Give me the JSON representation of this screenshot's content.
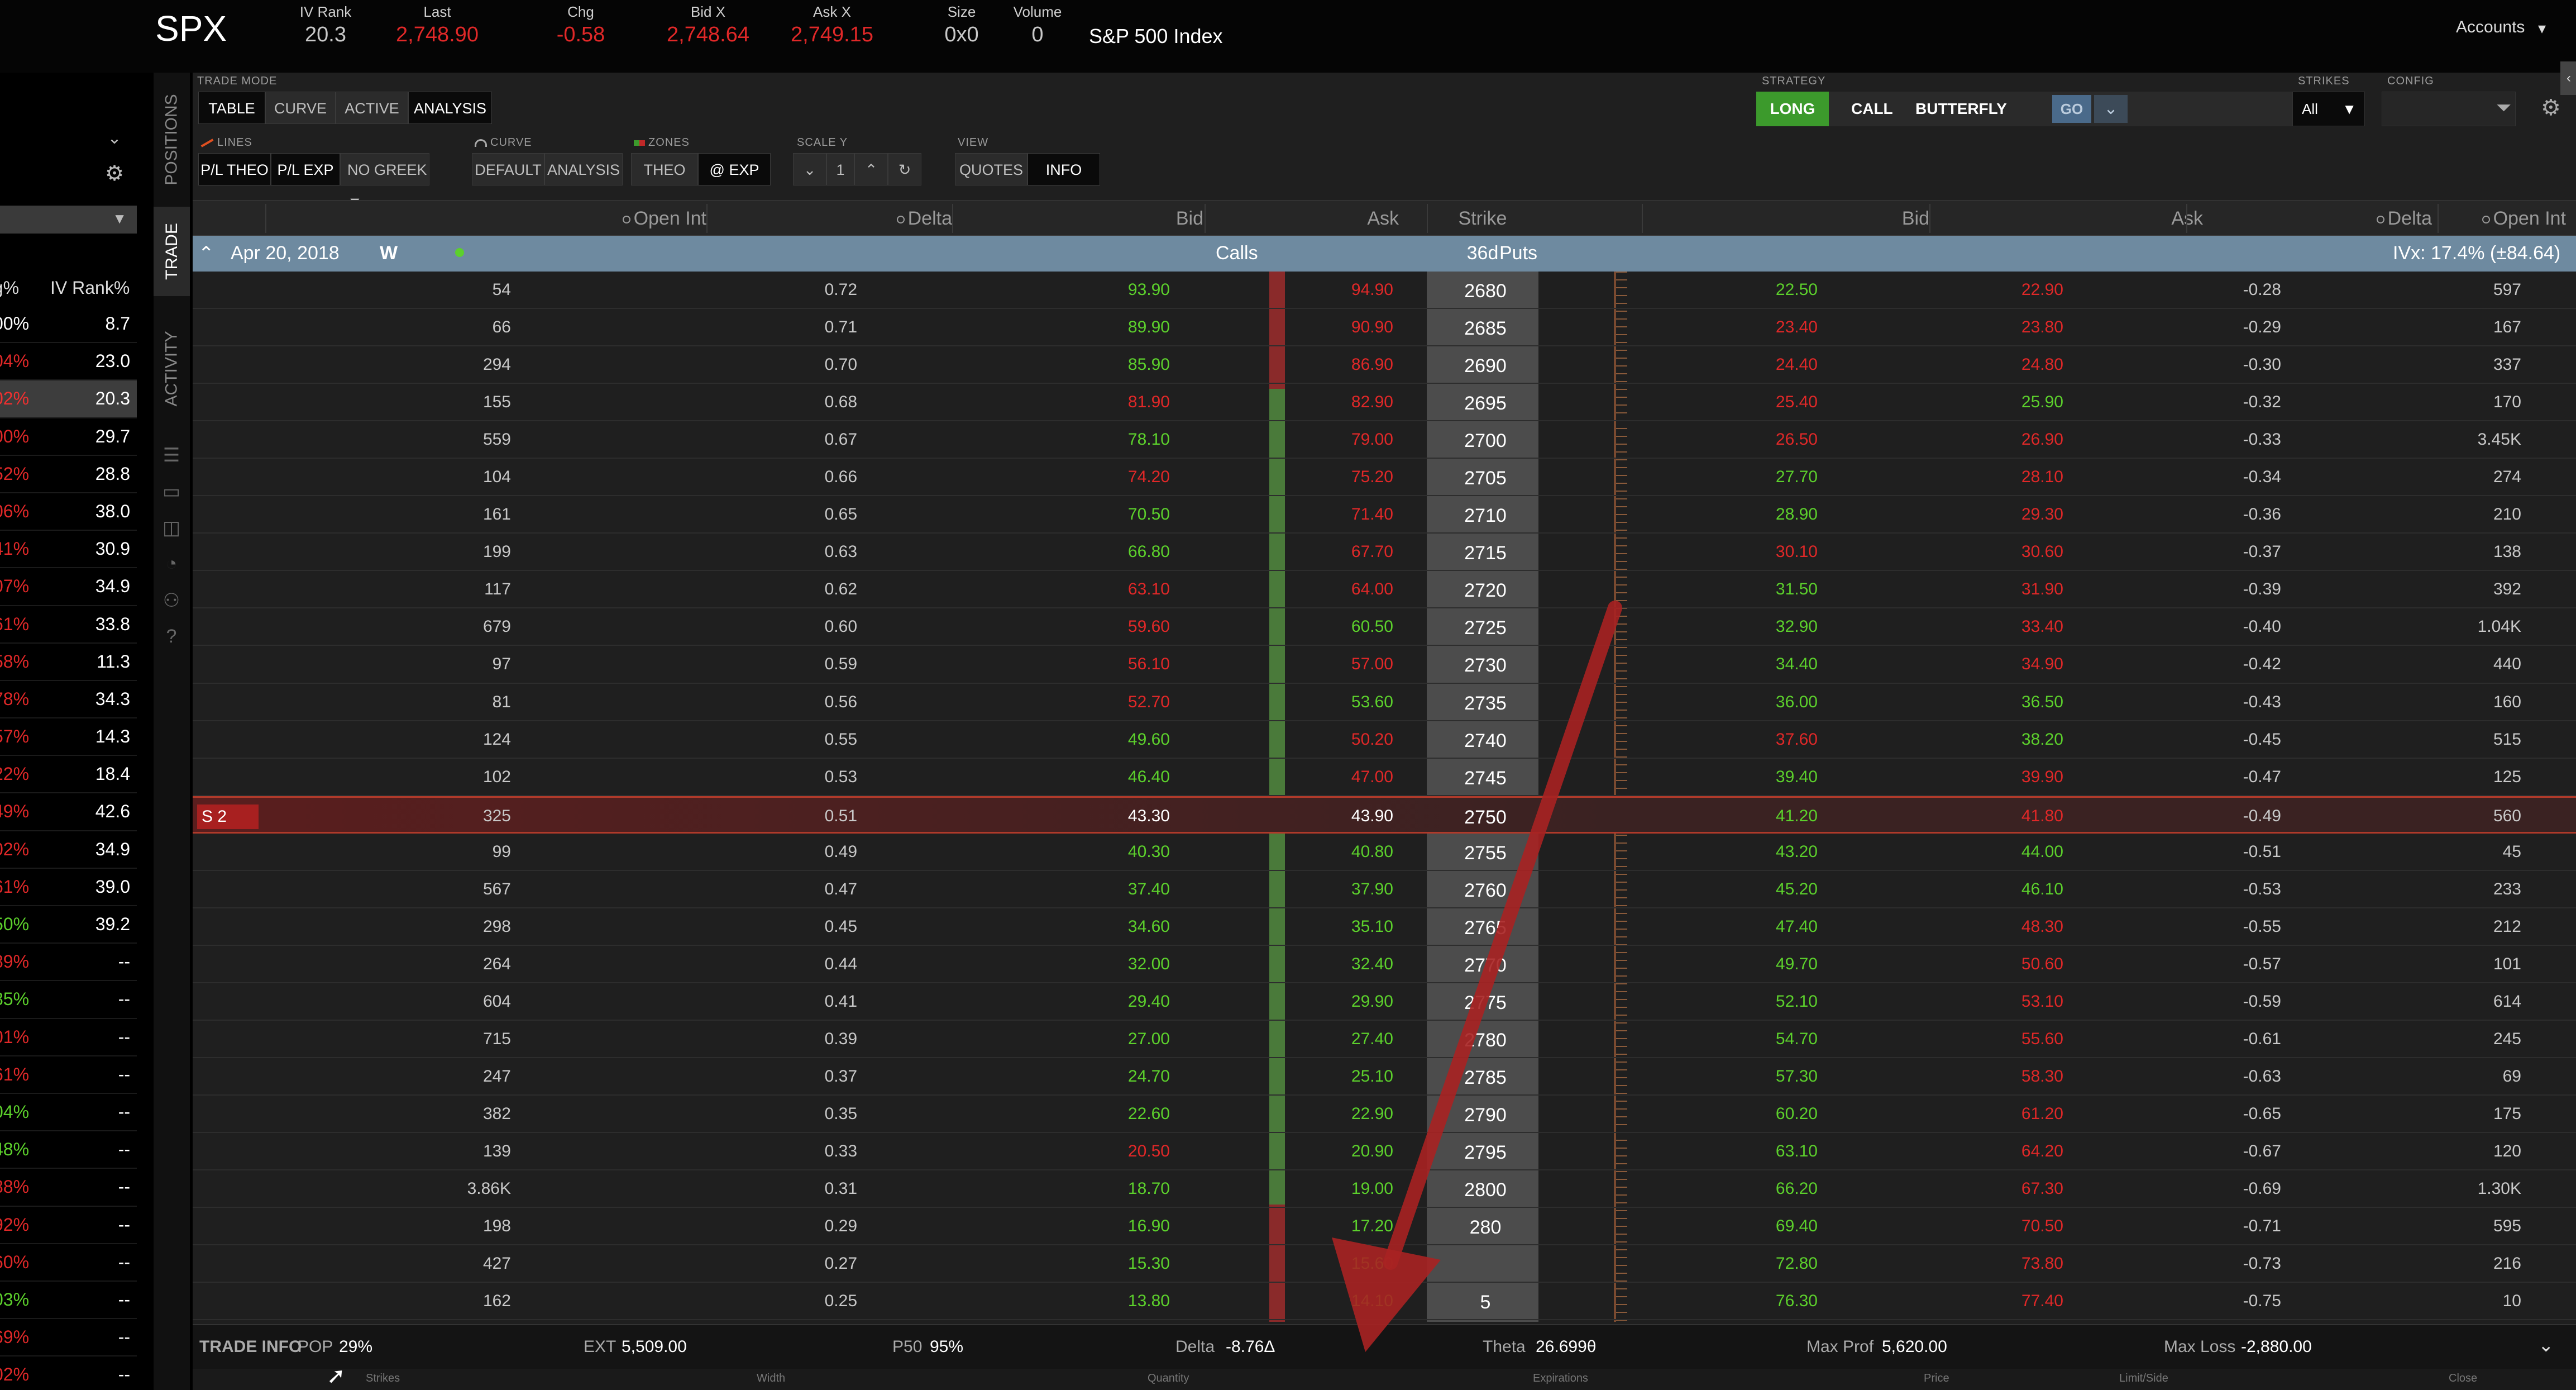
{
  "header": {
    "symbol": "SPX",
    "stats": [
      {
        "label": "IV Rank",
        "value": "20.3",
        "color": "grey"
      },
      {
        "label": "Last",
        "value": "2,748.90",
        "color": "red"
      },
      {
        "label": "Chg",
        "value": "-0.58",
        "color": "red"
      },
      {
        "label": "Bid X",
        "value": "2,748.64",
        "color": "red"
      },
      {
        "label": "Ask X",
        "value": "2,749.15",
        "color": "red"
      },
      {
        "label": "Size",
        "value": "0x0",
        "color": "grey"
      },
      {
        "label": "Volume",
        "value": "0",
        "color": "grey"
      }
    ],
    "index_name": "S&P 500 Index",
    "accounts_label": "Accounts"
  },
  "watchlist": {
    "col_pct": "hg%",
    "col_ivr": "IV Rank%",
    "rows": [
      {
        "pct": "00%",
        "ivr": "8.7",
        "pct_color": "white"
      },
      {
        "pct": "04%",
        "ivr": "23.0",
        "pct_color": "red"
      },
      {
        "pct": "02%",
        "ivr": "20.3",
        "pct_color": "red",
        "selected": true
      },
      {
        "pct": "00%",
        "ivr": "29.7",
        "pct_color": "red"
      },
      {
        "pct": "52%",
        "ivr": "28.8",
        "pct_color": "red"
      },
      {
        "pct": "06%",
        "ivr": "38.0",
        "pct_color": "red"
      },
      {
        "pct": "41%",
        "ivr": "30.9",
        "pct_color": "red"
      },
      {
        "pct": "07%",
        "ivr": "34.9",
        "pct_color": "red"
      },
      {
        "pct": "61%",
        "ivr": "33.8",
        "pct_color": "red"
      },
      {
        "pct": "58%",
        "ivr": "11.3",
        "pct_color": "red"
      },
      {
        "pct": "78%",
        "ivr": "34.3",
        "pct_color": "red"
      },
      {
        "pct": "57%",
        "ivr": "14.3",
        "pct_color": "red"
      },
      {
        "pct": "22%",
        "ivr": "18.4",
        "pct_color": "red"
      },
      {
        "pct": "49%",
        "ivr": "42.6",
        "pct_color": "red"
      },
      {
        "pct": "02%",
        "ivr": "34.9",
        "pct_color": "red"
      },
      {
        "pct": "61%",
        "ivr": "39.0",
        "pct_color": "red"
      },
      {
        "pct": "50%",
        "ivr": "39.2",
        "pct_color": "green"
      },
      {
        "pct": "89%",
        "ivr": "--",
        "pct_color": "red"
      },
      {
        "pct": "85%",
        "ivr": "--",
        "pct_color": "green"
      },
      {
        "pct": "01%",
        "ivr": "--",
        "pct_color": "red"
      },
      {
        "pct": "61%",
        "ivr": "--",
        "pct_color": "red"
      },
      {
        "pct": "04%",
        "ivr": "--",
        "pct_color": "green"
      },
      {
        "pct": "48%",
        "ivr": "--",
        "pct_color": "green"
      },
      {
        "pct": "88%",
        "ivr": "--",
        "pct_color": "red"
      },
      {
        "pct": "92%",
        "ivr": "--",
        "pct_color": "red"
      },
      {
        "pct": "60%",
        "ivr": "--",
        "pct_color": "red"
      },
      {
        "pct": "03%",
        "ivr": "--",
        "pct_color": "green"
      },
      {
        "pct": "69%",
        "ivr": "--",
        "pct_color": "red"
      },
      {
        "pct": "02%",
        "ivr": "--",
        "pct_color": "red"
      }
    ]
  },
  "vtabs": {
    "positions": "POSITIONS",
    "trade": "TRADE",
    "activity": "ACTIVITY"
  },
  "toolbar": {
    "trade_mode_label": "TRADE MODE",
    "modes": [
      "TABLE",
      "CURVE",
      "ACTIVE",
      "ANALYSIS"
    ],
    "lines_label": "LINES",
    "lines": [
      "P/L THEO",
      "P/L EXP"
    ],
    "greek": "NO GREEK",
    "curve_label": "CURVE",
    "curves": [
      "DEFAULT",
      "ANALYSIS"
    ],
    "zones_label": "ZONES",
    "zones": [
      "THEO",
      "@ EXP"
    ],
    "scale_label": "SCALE Y",
    "scale_value": "1",
    "view_label": "VIEW",
    "views": [
      "QUOTES",
      "INFO"
    ],
    "strategy_label": "STRATEGY",
    "strategy_side": "LONG",
    "strategy_type": "CALL",
    "strategy_name": "BUTTERFLY",
    "go": "GO",
    "strikes_label": "STRIKES",
    "strikes_value": "All",
    "config_label": "CONFIG"
  },
  "columns": {
    "open_int": "Open Int",
    "delta": "Delta",
    "bid": "Bid",
    "ask": "Ask",
    "strike": "Strike",
    "p_bid": "Bid",
    "p_ask": "Ask",
    "p_delta": "Delta",
    "p_open_int": "Open Int"
  },
  "series": {
    "expiry": "Apr 20, 2018",
    "tag": "W",
    "calls": "Calls",
    "dte": "36d",
    "puts": "Puts",
    "ivx": "IVx: 17.4% (±84.64)"
  },
  "chain": [
    {
      "oi": "54",
      "delta": "0.72",
      "bid": "93.90",
      "bid_c": "green",
      "ask": "94.90",
      "ask_c": "red",
      "strike": "2680",
      "pbid": "22.50",
      "pbid_c": "green",
      "pask": "22.90",
      "pask_c": "red",
      "pdelta": "-0.28",
      "poi": "597"
    },
    {
      "oi": "66",
      "delta": "0.71",
      "bid": "89.90",
      "bid_c": "green",
      "ask": "90.90",
      "ask_c": "red",
      "strike": "2685",
      "pbid": "23.40",
      "pbid_c": "red",
      "pask": "23.80",
      "pask_c": "red",
      "pdelta": "-0.29",
      "poi": "167"
    },
    {
      "oi": "294",
      "delta": "0.70",
      "bid": "85.90",
      "bid_c": "green",
      "ask": "86.90",
      "ask_c": "red",
      "strike": "2690",
      "pbid": "24.40",
      "pbid_c": "red",
      "pask": "24.80",
      "pask_c": "red",
      "pdelta": "-0.30",
      "poi": "337"
    },
    {
      "oi": "155",
      "delta": "0.68",
      "bid": "81.90",
      "bid_c": "red",
      "ask": "82.90",
      "ask_c": "red",
      "strike": "2695",
      "pbid": "25.40",
      "pbid_c": "red",
      "pask": "25.90",
      "pask_c": "green",
      "pdelta": "-0.32",
      "poi": "170"
    },
    {
      "oi": "559",
      "delta": "0.67",
      "bid": "78.10",
      "bid_c": "green",
      "ask": "79.00",
      "ask_c": "red",
      "strike": "2700",
      "pbid": "26.50",
      "pbid_c": "red",
      "pask": "26.90",
      "pask_c": "red",
      "pdelta": "-0.33",
      "poi": "3.45K"
    },
    {
      "oi": "104",
      "delta": "0.66",
      "bid": "74.20",
      "bid_c": "red",
      "ask": "75.20",
      "ask_c": "red",
      "strike": "2705",
      "pbid": "27.70",
      "pbid_c": "green",
      "pask": "28.10",
      "pask_c": "red",
      "pdelta": "-0.34",
      "poi": "274"
    },
    {
      "oi": "161",
      "delta": "0.65",
      "bid": "70.50",
      "bid_c": "green",
      "ask": "71.40",
      "ask_c": "red",
      "strike": "2710",
      "pbid": "28.90",
      "pbid_c": "green",
      "pask": "29.30",
      "pask_c": "red",
      "pdelta": "-0.36",
      "poi": "210"
    },
    {
      "oi": "199",
      "delta": "0.63",
      "bid": "66.80",
      "bid_c": "green",
      "ask": "67.70",
      "ask_c": "red",
      "strike": "2715",
      "pbid": "30.10",
      "pbid_c": "red",
      "pask": "30.60",
      "pask_c": "red",
      "pdelta": "-0.37",
      "poi": "138"
    },
    {
      "oi": "117",
      "delta": "0.62",
      "bid": "63.10",
      "bid_c": "red",
      "ask": "64.00",
      "ask_c": "red",
      "strike": "2720",
      "pbid": "31.50",
      "pbid_c": "green",
      "pask": "31.90",
      "pask_c": "red",
      "pdelta": "-0.39",
      "poi": "392"
    },
    {
      "oi": "679",
      "delta": "0.60",
      "bid": "59.60",
      "bid_c": "red",
      "ask": "60.50",
      "ask_c": "green",
      "strike": "2725",
      "pbid": "32.90",
      "pbid_c": "green",
      "pask": "33.40",
      "pask_c": "red",
      "pdelta": "-0.40",
      "poi": "1.04K"
    },
    {
      "oi": "97",
      "delta": "0.59",
      "bid": "56.10",
      "bid_c": "red",
      "ask": "57.00",
      "ask_c": "red",
      "strike": "2730",
      "pbid": "34.40",
      "pbid_c": "green",
      "pask": "34.90",
      "pask_c": "red",
      "pdelta": "-0.42",
      "poi": "440"
    },
    {
      "oi": "81",
      "delta": "0.56",
      "bid": "52.70",
      "bid_c": "red",
      "ask": "53.60",
      "ask_c": "green",
      "strike": "2735",
      "pbid": "36.00",
      "pbid_c": "green",
      "pask": "36.50",
      "pask_c": "green",
      "pdelta": "-0.43",
      "poi": "160"
    },
    {
      "oi": "124",
      "delta": "0.55",
      "bid": "49.60",
      "bid_c": "green",
      "ask": "50.20",
      "ask_c": "red",
      "strike": "2740",
      "pbid": "37.60",
      "pbid_c": "red",
      "pask": "38.20",
      "pask_c": "green",
      "pdelta": "-0.45",
      "poi": "515"
    },
    {
      "oi": "102",
      "delta": "0.53",
      "bid": "46.40",
      "bid_c": "green",
      "ask": "47.00",
      "ask_c": "red",
      "strike": "2745",
      "pbid": "39.40",
      "pbid_c": "green",
      "pask": "39.90",
      "pask_c": "red",
      "pdelta": "-0.47",
      "poi": "125"
    },
    {
      "oi": "325",
      "delta": "0.51",
      "bid": "43.30",
      "bid_c": "white",
      "ask": "43.90",
      "ask_c": "white",
      "strike": "2750",
      "pbid": "41.20",
      "pbid_c": "green",
      "pask": "41.80",
      "pask_c": "red",
      "pdelta": "-0.49",
      "poi": "560",
      "atm": true,
      "tag": "S 2"
    },
    {
      "oi": "99",
      "delta": "0.49",
      "bid": "40.30",
      "bid_c": "green",
      "ask": "40.80",
      "ask_c": "green",
      "strike": "2755",
      "pbid": "43.20",
      "pbid_c": "green",
      "pask": "44.00",
      "pask_c": "green",
      "pdelta": "-0.51",
      "poi": "45"
    },
    {
      "oi": "567",
      "delta": "0.47",
      "bid": "37.40",
      "bid_c": "green",
      "ask": "37.90",
      "ask_c": "green",
      "strike": "2760",
      "pbid": "45.20",
      "pbid_c": "green",
      "pask": "46.10",
      "pask_c": "green",
      "pdelta": "-0.53",
      "poi": "233"
    },
    {
      "oi": "298",
      "delta": "0.45",
      "bid": "34.60",
      "bid_c": "green",
      "ask": "35.10",
      "ask_c": "green",
      "strike": "2765",
      "pbid": "47.40",
      "pbid_c": "green",
      "pask": "48.30",
      "pask_c": "red",
      "pdelta": "-0.55",
      "poi": "212"
    },
    {
      "oi": "264",
      "delta": "0.44",
      "bid": "32.00",
      "bid_c": "green",
      "ask": "32.40",
      "ask_c": "green",
      "strike": "2770",
      "pbid": "49.70",
      "pbid_c": "green",
      "pask": "50.60",
      "pask_c": "red",
      "pdelta": "-0.57",
      "poi": "101"
    },
    {
      "oi": "604",
      "delta": "0.41",
      "bid": "29.40",
      "bid_c": "green",
      "ask": "29.90",
      "ask_c": "green",
      "strike": "2775",
      "pbid": "52.10",
      "pbid_c": "green",
      "pask": "53.10",
      "pask_c": "red",
      "pdelta": "-0.59",
      "poi": "614"
    },
    {
      "oi": "715",
      "delta": "0.39",
      "bid": "27.00",
      "bid_c": "green",
      "ask": "27.40",
      "ask_c": "green",
      "strike": "2780",
      "pbid": "54.70",
      "pbid_c": "green",
      "pask": "55.60",
      "pask_c": "red",
      "pdelta": "-0.61",
      "poi": "245"
    },
    {
      "oi": "247",
      "delta": "0.37",
      "bid": "24.70",
      "bid_c": "green",
      "ask": "25.10",
      "ask_c": "green",
      "strike": "2785",
      "pbid": "57.30",
      "pbid_c": "green",
      "pask": "58.30",
      "pask_c": "red",
      "pdelta": "-0.63",
      "poi": "69"
    },
    {
      "oi": "382",
      "delta": "0.35",
      "bid": "22.60",
      "bid_c": "green",
      "ask": "22.90",
      "ask_c": "green",
      "strike": "2790",
      "pbid": "60.20",
      "pbid_c": "green",
      "pask": "61.20",
      "pask_c": "red",
      "pdelta": "-0.65",
      "poi": "175"
    },
    {
      "oi": "139",
      "delta": "0.33",
      "bid": "20.50",
      "bid_c": "red",
      "ask": "20.90",
      "ask_c": "green",
      "strike": "2795",
      "pbid": "63.10",
      "pbid_c": "green",
      "pask": "64.20",
      "pask_c": "red",
      "pdelta": "-0.67",
      "poi": "120"
    },
    {
      "oi": "3.86K",
      "delta": "0.31",
      "bid": "18.70",
      "bid_c": "green",
      "ask": "19.00",
      "ask_c": "green",
      "strike": "2800",
      "pbid": "66.20",
      "pbid_c": "green",
      "pask": "67.30",
      "pask_c": "red",
      "pdelta": "-0.69",
      "poi": "1.30K"
    },
    {
      "oi": "198",
      "delta": "0.29",
      "bid": "16.90",
      "bid_c": "green",
      "ask": "17.20",
      "ask_c": "green",
      "strike": "280",
      "pbid": "69.40",
      "pbid_c": "green",
      "pask": "70.50",
      "pask_c": "red",
      "pdelta": "-0.71",
      "poi": "595"
    },
    {
      "oi": "427",
      "delta": "0.27",
      "bid": "15.30",
      "bid_c": "green",
      "ask": "15.60",
      "ask_c": "green",
      "strike": "",
      "pbid": "72.80",
      "pbid_c": "green",
      "pask": "73.80",
      "pask_c": "red",
      "pdelta": "-0.73",
      "poi": "216"
    },
    {
      "oi": "162",
      "delta": "0.25",
      "bid": "13.80",
      "bid_c": "green",
      "ask": "14.10",
      "ask_c": "green",
      "strike": "5",
      "pbid": "76.30",
      "pbid_c": "green",
      "pask": "77.40",
      "pask_c": "red",
      "pdelta": "-0.75",
      "poi": "10"
    }
  ],
  "trade_info": {
    "label": "TRADE INFO",
    "pop_label": "POP",
    "pop": "29%",
    "ext_label": "EXT",
    "ext": "5,509.00",
    "p50_label": "P50",
    "p50": "95%",
    "delta_label": "Delta",
    "delta": "-8.76Δ",
    "theta_label": "Theta",
    "theta": "26.699θ",
    "maxprof_label": "Max Prof",
    "maxprof": "5,620.00",
    "maxloss_label": "Max Loss",
    "maxloss": "-2,880.00"
  },
  "subhead": [
    "Strikes",
    "Width",
    "Quantity",
    "Expirations",
    "Price",
    "Limit/Side",
    "Close"
  ],
  "colors": {
    "green": "#5cd02c",
    "red": "#e02828",
    "accent_long": "#3c9a2c",
    "arrow": "#b02222"
  }
}
